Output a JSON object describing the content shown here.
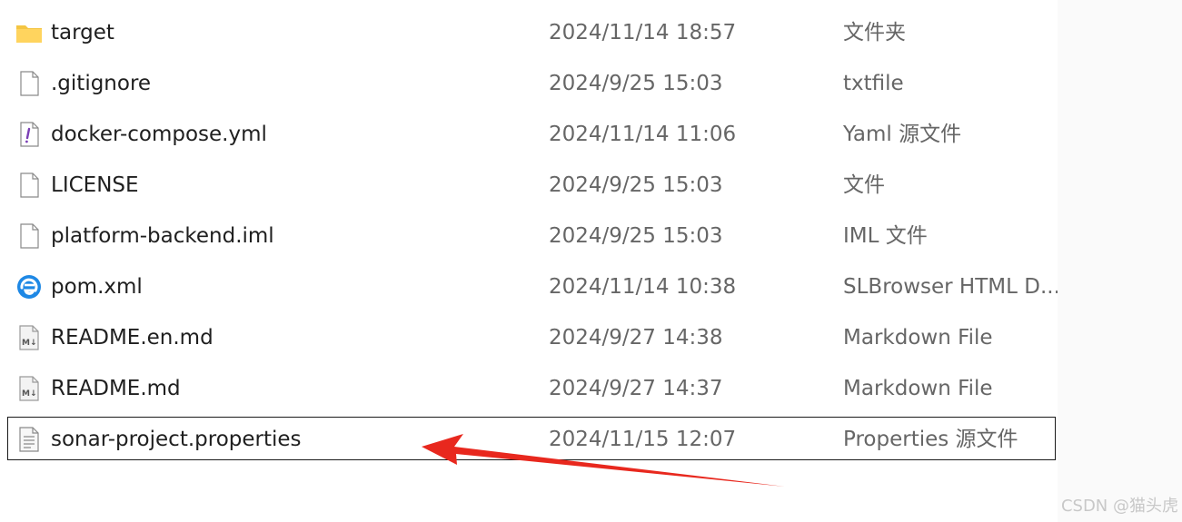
{
  "files": [
    {
      "name": "target",
      "date": "2024/11/14 18:57",
      "type": "文件夹",
      "icon": "folder-icon"
    },
    {
      "name": ".gitignore",
      "date": "2024/9/25 15:03",
      "type": "txtfile",
      "icon": "file-icon"
    },
    {
      "name": "docker-compose.yml",
      "date": "2024/11/14 11:06",
      "type": "Yaml 源文件",
      "icon": "yaml-file-icon"
    },
    {
      "name": "LICENSE",
      "date": "2024/9/25 15:03",
      "type": "文件",
      "icon": "file-icon"
    },
    {
      "name": "platform-backend.iml",
      "date": "2024/9/25 15:03",
      "type": "IML 文件",
      "icon": "file-icon"
    },
    {
      "name": "pom.xml",
      "date": "2024/11/14 10:38",
      "type": "SLBrowser HTML D...",
      "icon": "browser-icon"
    },
    {
      "name": "README.en.md",
      "date": "2024/9/27 14:38",
      "type": "Markdown File",
      "icon": "markdown-file-icon"
    },
    {
      "name": "README.md",
      "date": "2024/9/27 14:37",
      "type": "Markdown File",
      "icon": "markdown-file-icon"
    },
    {
      "name": "sonar-project.properties",
      "date": "2024/11/15 12:07",
      "type": "Properties 源文件",
      "icon": "properties-file-icon",
      "selected": true
    }
  ],
  "watermark": "CSDN @猫头虎",
  "colors": {
    "folder": "#f4c542",
    "arrow": "#e8281e",
    "browser": "#1e88e5"
  }
}
